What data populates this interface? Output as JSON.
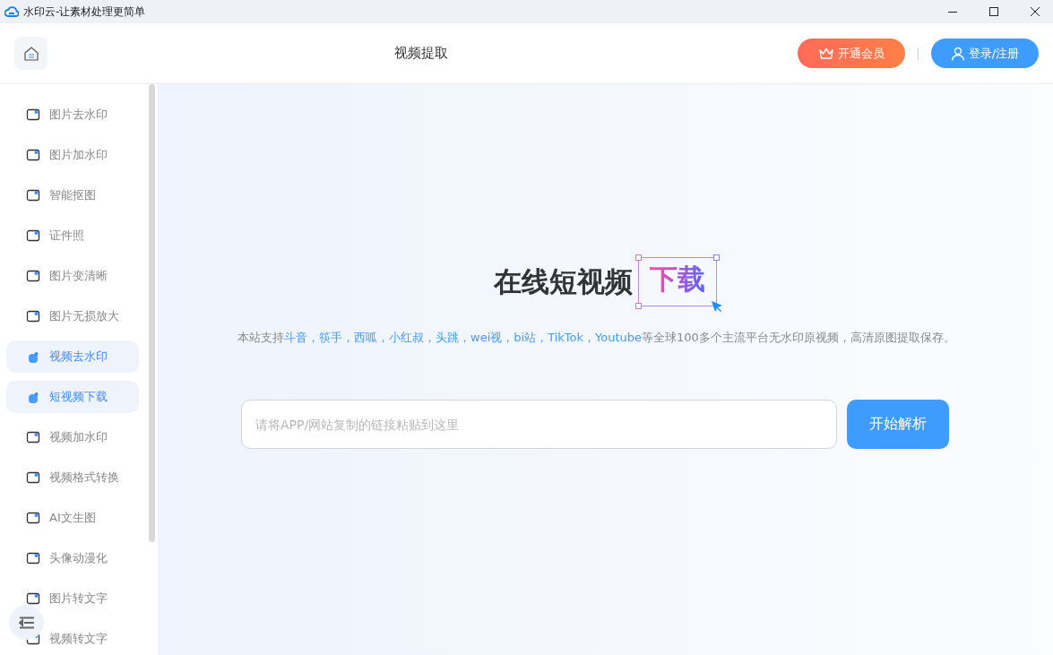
{
  "window": {
    "title": "水印云-让素材处理更简单"
  },
  "header": {
    "title": "视频提取",
    "vip_button": "开通会员",
    "login_button": "登录/注册"
  },
  "sidebar": {
    "items": [
      {
        "label": "图片去水印",
        "selected": false
      },
      {
        "label": "图片加水印",
        "selected": false
      },
      {
        "label": "智能抠图",
        "selected": false
      },
      {
        "label": "证件照",
        "selected": false
      },
      {
        "label": "图片变清晰",
        "selected": false
      },
      {
        "label": "图片无损放大",
        "selected": false
      },
      {
        "label": "视频去水印",
        "selected": true
      },
      {
        "label": "短视频下载",
        "selected": true
      },
      {
        "label": "视频加水印",
        "selected": false
      },
      {
        "label": "视频格式转换",
        "selected": false
      },
      {
        "label": "AI文生图",
        "selected": false
      },
      {
        "label": "头像动漫化",
        "selected": false
      },
      {
        "label": "图片转文字",
        "selected": false
      },
      {
        "label": "视频转文字",
        "selected": false
      }
    ]
  },
  "hero": {
    "title": "在线短视频",
    "highlight": "下载",
    "description": [
      {
        "text": "本站支持",
        "link": false
      },
      {
        "text": "斗音，筷手，西呱，小红叔，头跳，wei视，bi站，TikTok，Youtube",
        "link": true
      },
      {
        "text": "等全球100多个主流平台无水印原视频，高清原图提取保存。",
        "link": false
      }
    ]
  },
  "search": {
    "placeholder": "请将APP/网站复制的链接粘贴到这里",
    "button": "开始解析"
  }
}
